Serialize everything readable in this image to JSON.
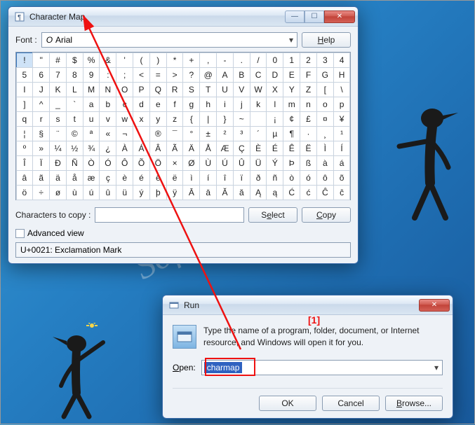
{
  "watermark": "Softwareok.com",
  "charmap": {
    "title": "Character Map",
    "font_label": "Font :",
    "font_value": "Arial",
    "font_prefix": "O",
    "help_label": "Help",
    "grid": [
      "!",
      "\"",
      "#",
      "$",
      "%",
      "&",
      "'",
      "(",
      ")",
      "*",
      "+",
      ",",
      "-",
      ".",
      "/",
      "0",
      "1",
      "2",
      "3",
      "4",
      "5",
      "6",
      "7",
      "8",
      "9",
      ":",
      ";",
      "<",
      "=",
      ">",
      "?",
      "@",
      "A",
      "B",
      "C",
      "D",
      "E",
      "F",
      "G",
      "H",
      "I",
      "J",
      "K",
      "L",
      "M",
      "N",
      "O",
      "P",
      "Q",
      "R",
      "S",
      "T",
      "U",
      "V",
      "W",
      "X",
      "Y",
      "Z",
      "[",
      "\\",
      "]",
      "^",
      "_",
      "`",
      "a",
      "b",
      "c",
      "d",
      "e",
      "f",
      "g",
      "h",
      "i",
      "j",
      "k",
      "l",
      "m",
      "n",
      "o",
      "p",
      "q",
      "r",
      "s",
      "t",
      "u",
      "v",
      "w",
      "x",
      "y",
      "z",
      "{",
      "|",
      "}",
      "~",
      "",
      "¡",
      "¢",
      "£",
      "¤",
      "¥",
      "¦",
      "§",
      "¨",
      "©",
      "ª",
      "«",
      "¬",
      "­",
      "®",
      "¯",
      "°",
      "±",
      "²",
      "³",
      "´",
      "µ",
      "¶",
      "·",
      "¸",
      "¹",
      "º",
      "»",
      "¼",
      "½",
      "¾",
      "¿",
      "À",
      "Á",
      "Â",
      "Ã",
      "Ä",
      "Å",
      "Æ",
      "Ç",
      "È",
      "É",
      "Ê",
      "Ë",
      "Ì",
      "Í",
      "Î",
      "Ï",
      "Ð",
      "Ñ",
      "Ò",
      "Ó",
      "Ô",
      "Õ",
      "Ö",
      "×",
      "Ø",
      "Ù",
      "Ú",
      "Û",
      "Ü",
      "Ý",
      "Þ",
      "ß",
      "à",
      "á",
      "â",
      "ã",
      "ä",
      "å",
      "æ",
      "ç",
      "è",
      "é",
      "ê",
      "ë",
      "ì",
      "í",
      "î",
      "ï",
      "ð",
      "ñ",
      "ò",
      "ó",
      "ô",
      "õ",
      "ö",
      "÷",
      "ø",
      "ù",
      "ú",
      "û",
      "ü",
      "ý",
      "þ",
      "ÿ",
      "Ā",
      "ā",
      "Ă",
      "ă",
      "Ą",
      "ą",
      "Ć",
      "ć",
      "Ĉ",
      "ĉ"
    ],
    "copy_label": "Characters to copy :",
    "select_btn": "Select",
    "copy_btn": "Copy",
    "advanced_label": "Advanced view",
    "status": "U+0021: Exclamation Mark"
  },
  "run": {
    "title": "Run",
    "desc": "Type the name of a program, folder, document, or Internet resource, and Windows will open it for you.",
    "open_label": "Open:",
    "value": "charmap",
    "ok": "OK",
    "cancel": "Cancel",
    "browse": "Browse..."
  },
  "annotation_label": "[1]"
}
